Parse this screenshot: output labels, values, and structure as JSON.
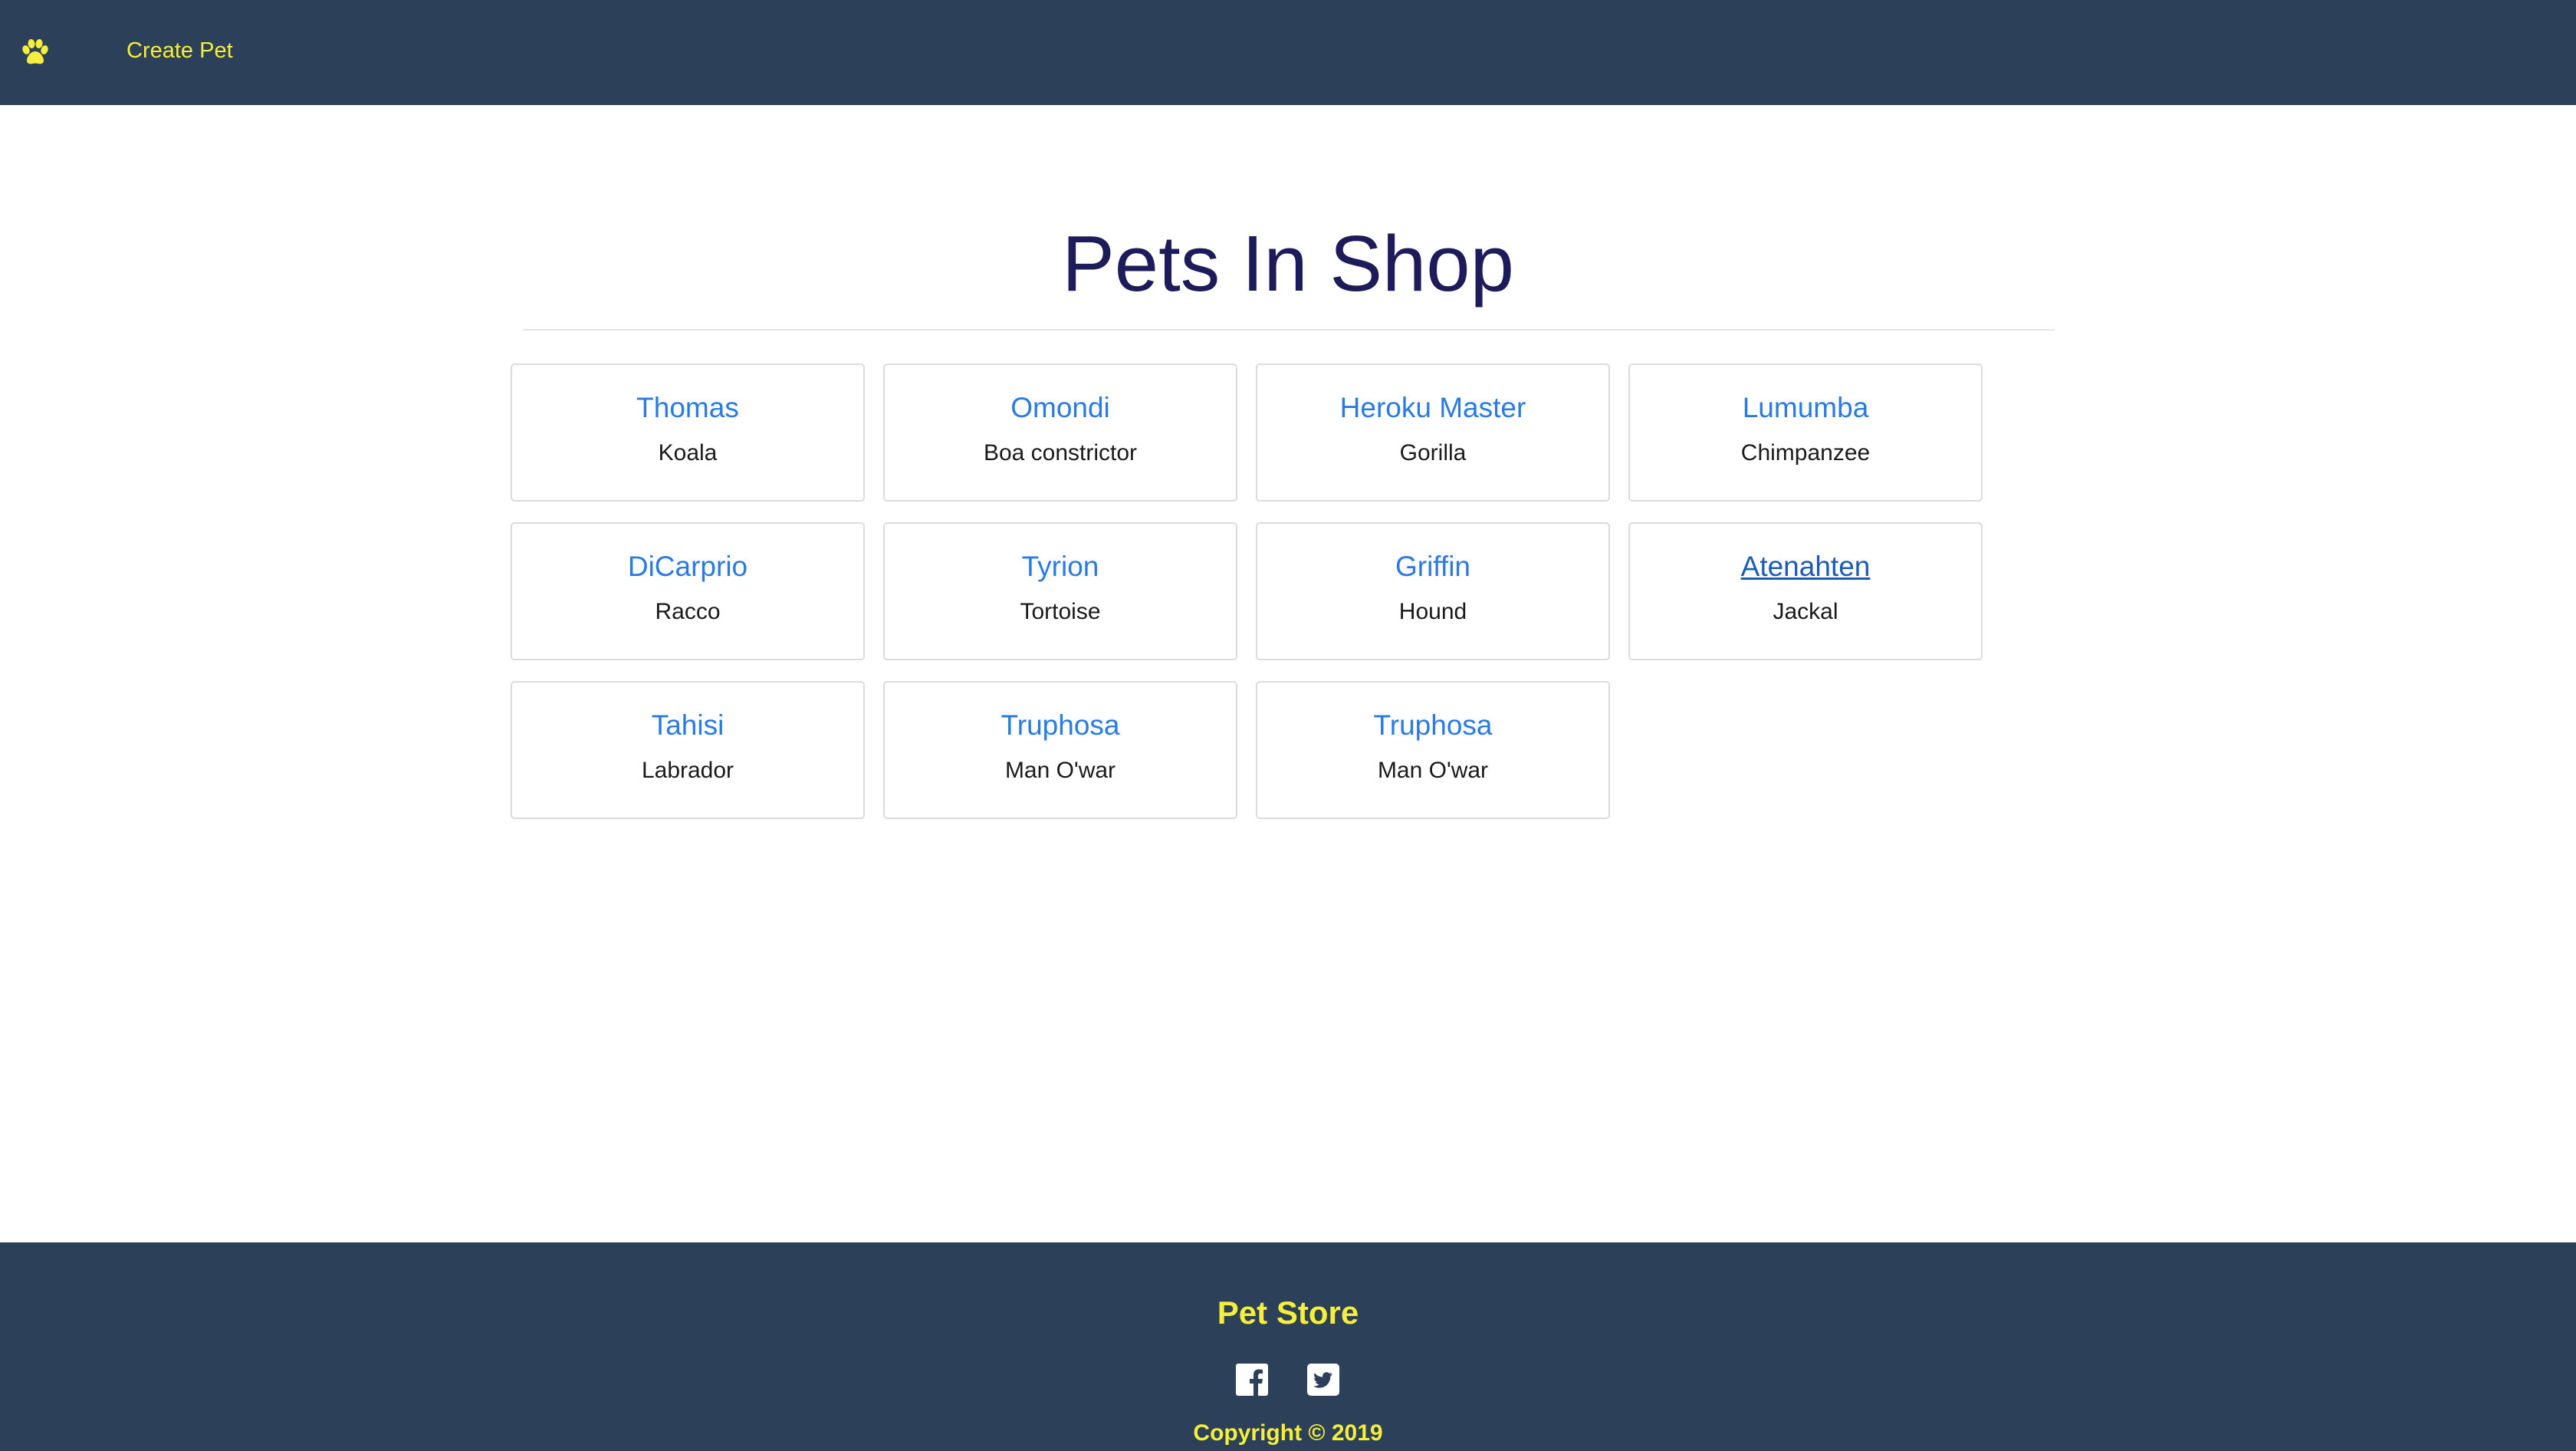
{
  "navbar": {
    "logo_icon": "paw-icon",
    "create_pet_label": "Create Pet",
    "background": "#2c405a",
    "accent": "#f5ee3a"
  },
  "main": {
    "title": "Pets In Shop",
    "pets": [
      {
        "name": "Thomas",
        "species": "Koala"
      },
      {
        "name": "Omondi",
        "species": "Boa constrictor"
      },
      {
        "name": "Heroku Master",
        "species": "Gorilla"
      },
      {
        "name": "Lumumba",
        "species": "Chimpanzee"
      },
      {
        "name": "DiCarprio",
        "species": "Racco"
      },
      {
        "name": "Tyrion",
        "species": "Tortoise"
      },
      {
        "name": "Griffin",
        "species": "Hound"
      },
      {
        "name": "Atenahten",
        "species": "Jackal"
      },
      {
        "name": "Tahisi",
        "species": "Labrador"
      },
      {
        "name": "Truphosa",
        "species": "Man O'war"
      },
      {
        "name": "Truphosa",
        "species": "Man O'war"
      }
    ],
    "name_color": "#2a7ae2"
  },
  "footer": {
    "brand": "Pet Store",
    "social_icons": [
      "facebook-icon",
      "twitter-icon"
    ],
    "copyright": "Copyright © 2019"
  }
}
